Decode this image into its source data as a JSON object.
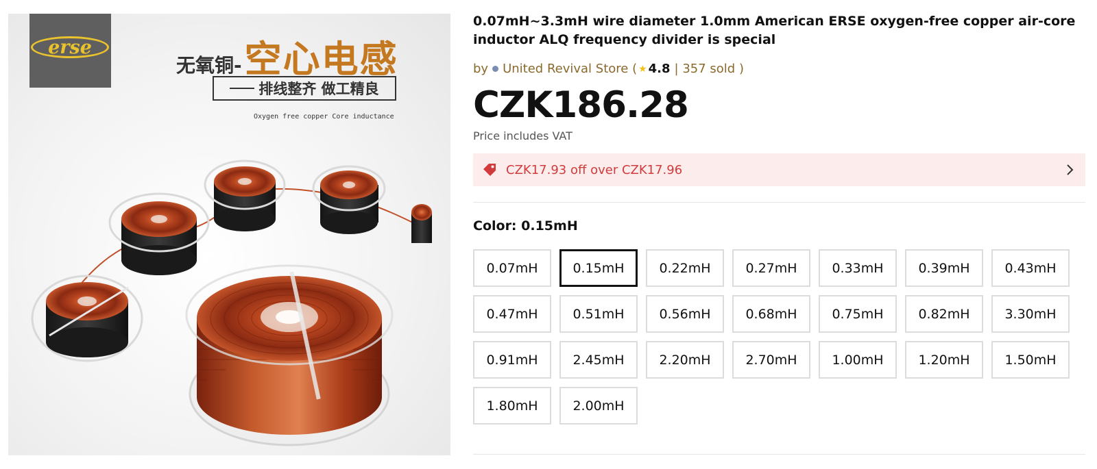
{
  "image": {
    "logo_text": "erse",
    "headline_small": "无氧铜-",
    "headline_big": "空心电感",
    "tagline": "排线整齐 做工精良",
    "caption": "Oxygen free copper Core inductance"
  },
  "product": {
    "title": "0.07mH~3.3mH wire diameter 1.0mm American ERSE oxygen-free copper air-core inductor ALQ frequency divider is special",
    "by_label": "by",
    "store_name": "United Revival Store (",
    "rating": "4.8",
    "sold": "| 357 sold )",
    "price": "CZK186.28",
    "vat_note": "Price includes VAT",
    "promo_text": "CZK17.93 off over CZK17.96",
    "color_label": "Color: 0.15mH",
    "selected_option": "0.15mH",
    "options": [
      "0.07mH",
      "0.15mH",
      "0.22mH",
      "0.27mH",
      "0.33mH",
      "0.39mH",
      "0.43mH",
      "0.47mH",
      "0.51mH",
      "0.56mH",
      "0.68mH",
      "0.75mH",
      "0.82mH",
      "3.30mH",
      "0.91mH",
      "2.45mH",
      "2.20mH",
      "2.70mH",
      "1.00mH",
      "1.20mH",
      "1.50mH",
      "1.80mH",
      "2.00mH"
    ]
  },
  "colors": {
    "promo_bg": "#fdecec",
    "promo_text": "#d23b3b",
    "store_text": "#8a6a2c",
    "star": "#f2c21b",
    "copper": "#b0401e"
  },
  "icons": {
    "promo": "price-tag-icon",
    "promo_arrow": "chevron-right-icon",
    "rating": "star-icon",
    "store": "store-badge-icon"
  }
}
